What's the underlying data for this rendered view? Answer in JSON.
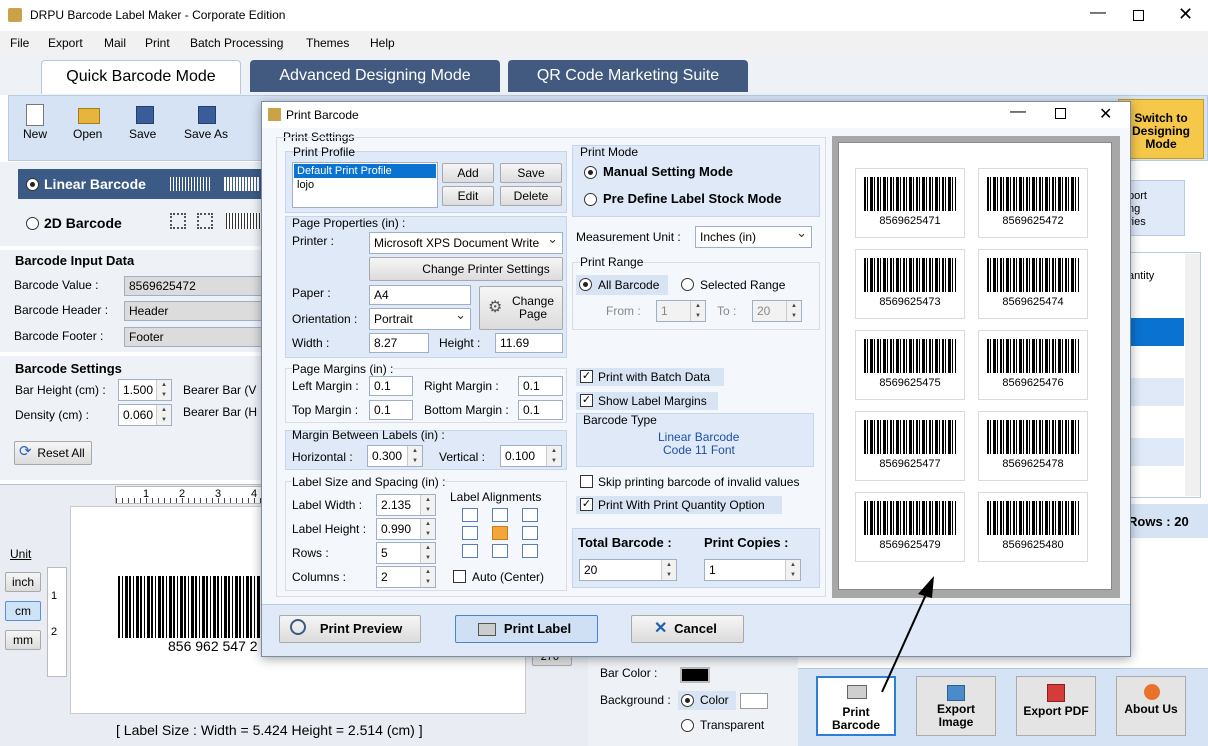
{
  "window": {
    "title": "DRPU Barcode Label Maker - Corporate Edition"
  },
  "menu": [
    "File",
    "Export",
    "Mail",
    "Print",
    "Batch Processing",
    "Themes",
    "Help"
  ],
  "tabs": [
    "Quick Barcode Mode",
    "Advanced Designing Mode",
    "QR Code Marketing Suite"
  ],
  "toolbar": {
    "new": "New",
    "open": "Open",
    "save": "Save",
    "save_as": "Save As",
    "switch": "Switch to Designing Mode"
  },
  "type_select": {
    "linear": "Linear Barcode",
    "two_d": "2D Barcode"
  },
  "right_side": {
    "export_lib_partial": "port\nng\nries",
    "list_head_partial": "t\nantity",
    "rows_label": "Rows : 20"
  },
  "input_data": {
    "heading": "Barcode Input Data",
    "value_label": "Barcode Value :",
    "value": "8569625472",
    "header_label": "Barcode Header :",
    "header": "Header",
    "footer_label": "Barcode Footer :",
    "footer": "Footer"
  },
  "settings": {
    "heading": "Barcode Settings",
    "bar_height_label": "Bar Height (cm) :",
    "bar_height": "1.500",
    "density_label": "Density (cm) :",
    "density": "0.060",
    "bearer_v": "Bearer Bar (V",
    "bearer_h": "Bearer Bar (H",
    "reset": "Reset All"
  },
  "units": {
    "label": "Unit",
    "inch": "inch",
    "cm": "cm",
    "mm": "mm"
  },
  "ruler": [
    "1",
    "2",
    "3",
    "4"
  ],
  "canvas": {
    "barcode_text": "856 962 547 2",
    "rot": "270°"
  },
  "status": "[ Label Size : Width = 5.424  Height = 2.514 (cm) ]",
  "color_opts": {
    "bar_color": "Bar Color :",
    "background": "Background :",
    "color": "Color",
    "transparent": "Transparent"
  },
  "bottom_buttons": {
    "print": "Print Barcode",
    "export_image": "Export Image",
    "export_pdf": "Export PDF",
    "about": "About Us"
  },
  "dialog": {
    "title": "Print Barcode",
    "print_settings": "Print Settings",
    "profile": {
      "heading": "Print Profile",
      "items": [
        "Default Print Profile",
        "lojo"
      ],
      "add": "Add",
      "save": "Save",
      "edit": "Edit",
      "delete": "Delete"
    },
    "page": {
      "heading": "Page Properties (in) :",
      "printer_label": "Printer :",
      "printer": "Microsoft XPS Document Write",
      "change_printer": "Change Printer Settings",
      "paper_label": "Paper :",
      "paper": "A4",
      "orientation_label": "Orientation :",
      "orientation": "Portrait",
      "change_page": "Change Page",
      "width_label": "Width :",
      "width": "8.27",
      "height_label": "Height :",
      "height": "11.69"
    },
    "margins": {
      "heading": "Page Margins (in) :",
      "left_label": "Left Margin :",
      "left": "0.1",
      "right_label": "Right Margin :",
      "right": "0.1",
      "top_label": "Top Margin :",
      "top": "0.1",
      "bottom_label": "Bottom Margin :",
      "bottom": "0.1"
    },
    "between": {
      "heading": "Margin Between Labels (in) :",
      "h_label": "Horizontal :",
      "h": "0.300",
      "v_label": "Vertical :",
      "v": "0.100"
    },
    "size": {
      "heading": "Label Size and Spacing (in) :",
      "w_label": "Label Width :",
      "w": "2.135",
      "h_label": "Label Height :",
      "h": "0.990",
      "rows_label": "Rows :",
      "rows": "5",
      "cols_label": "Columns :",
      "cols": "2",
      "align_label": "Label Alignments",
      "auto": "Auto (Center)"
    },
    "mode": {
      "heading": "Print Mode",
      "manual": "Manual Setting Mode",
      "predefine": "Pre Define Label Stock Mode"
    },
    "measure": {
      "label": "Measurement Unit :",
      "value": "Inches (in)"
    },
    "range": {
      "heading": "Print Range",
      "all": "All Barcode",
      "selected": "Selected Range",
      "from_label": "From :",
      "from": "1",
      "to_label": "To :",
      "to": "20"
    },
    "options": {
      "batch": "Print with Batch Data",
      "margins": "Show Label Margins",
      "type_heading": "Barcode Type",
      "type_line1": "Linear Barcode",
      "type_line2": "Code 11 Font",
      "skip": "Skip printing barcode of invalid values",
      "qty": "Print With Print Quantity Option"
    },
    "totals": {
      "total_label": "Total Barcode :",
      "total": "20",
      "copies_label": "Print Copies :",
      "copies": "1"
    },
    "preview_labels": [
      "8569625471",
      "8569625472",
      "8569625473",
      "8569625474",
      "8569625475",
      "8569625476",
      "8569625477",
      "8569625478",
      "8569625479",
      "8569625480"
    ],
    "buttons": {
      "preview": "Print Preview",
      "print": "Print Label",
      "cancel": "Cancel"
    }
  }
}
